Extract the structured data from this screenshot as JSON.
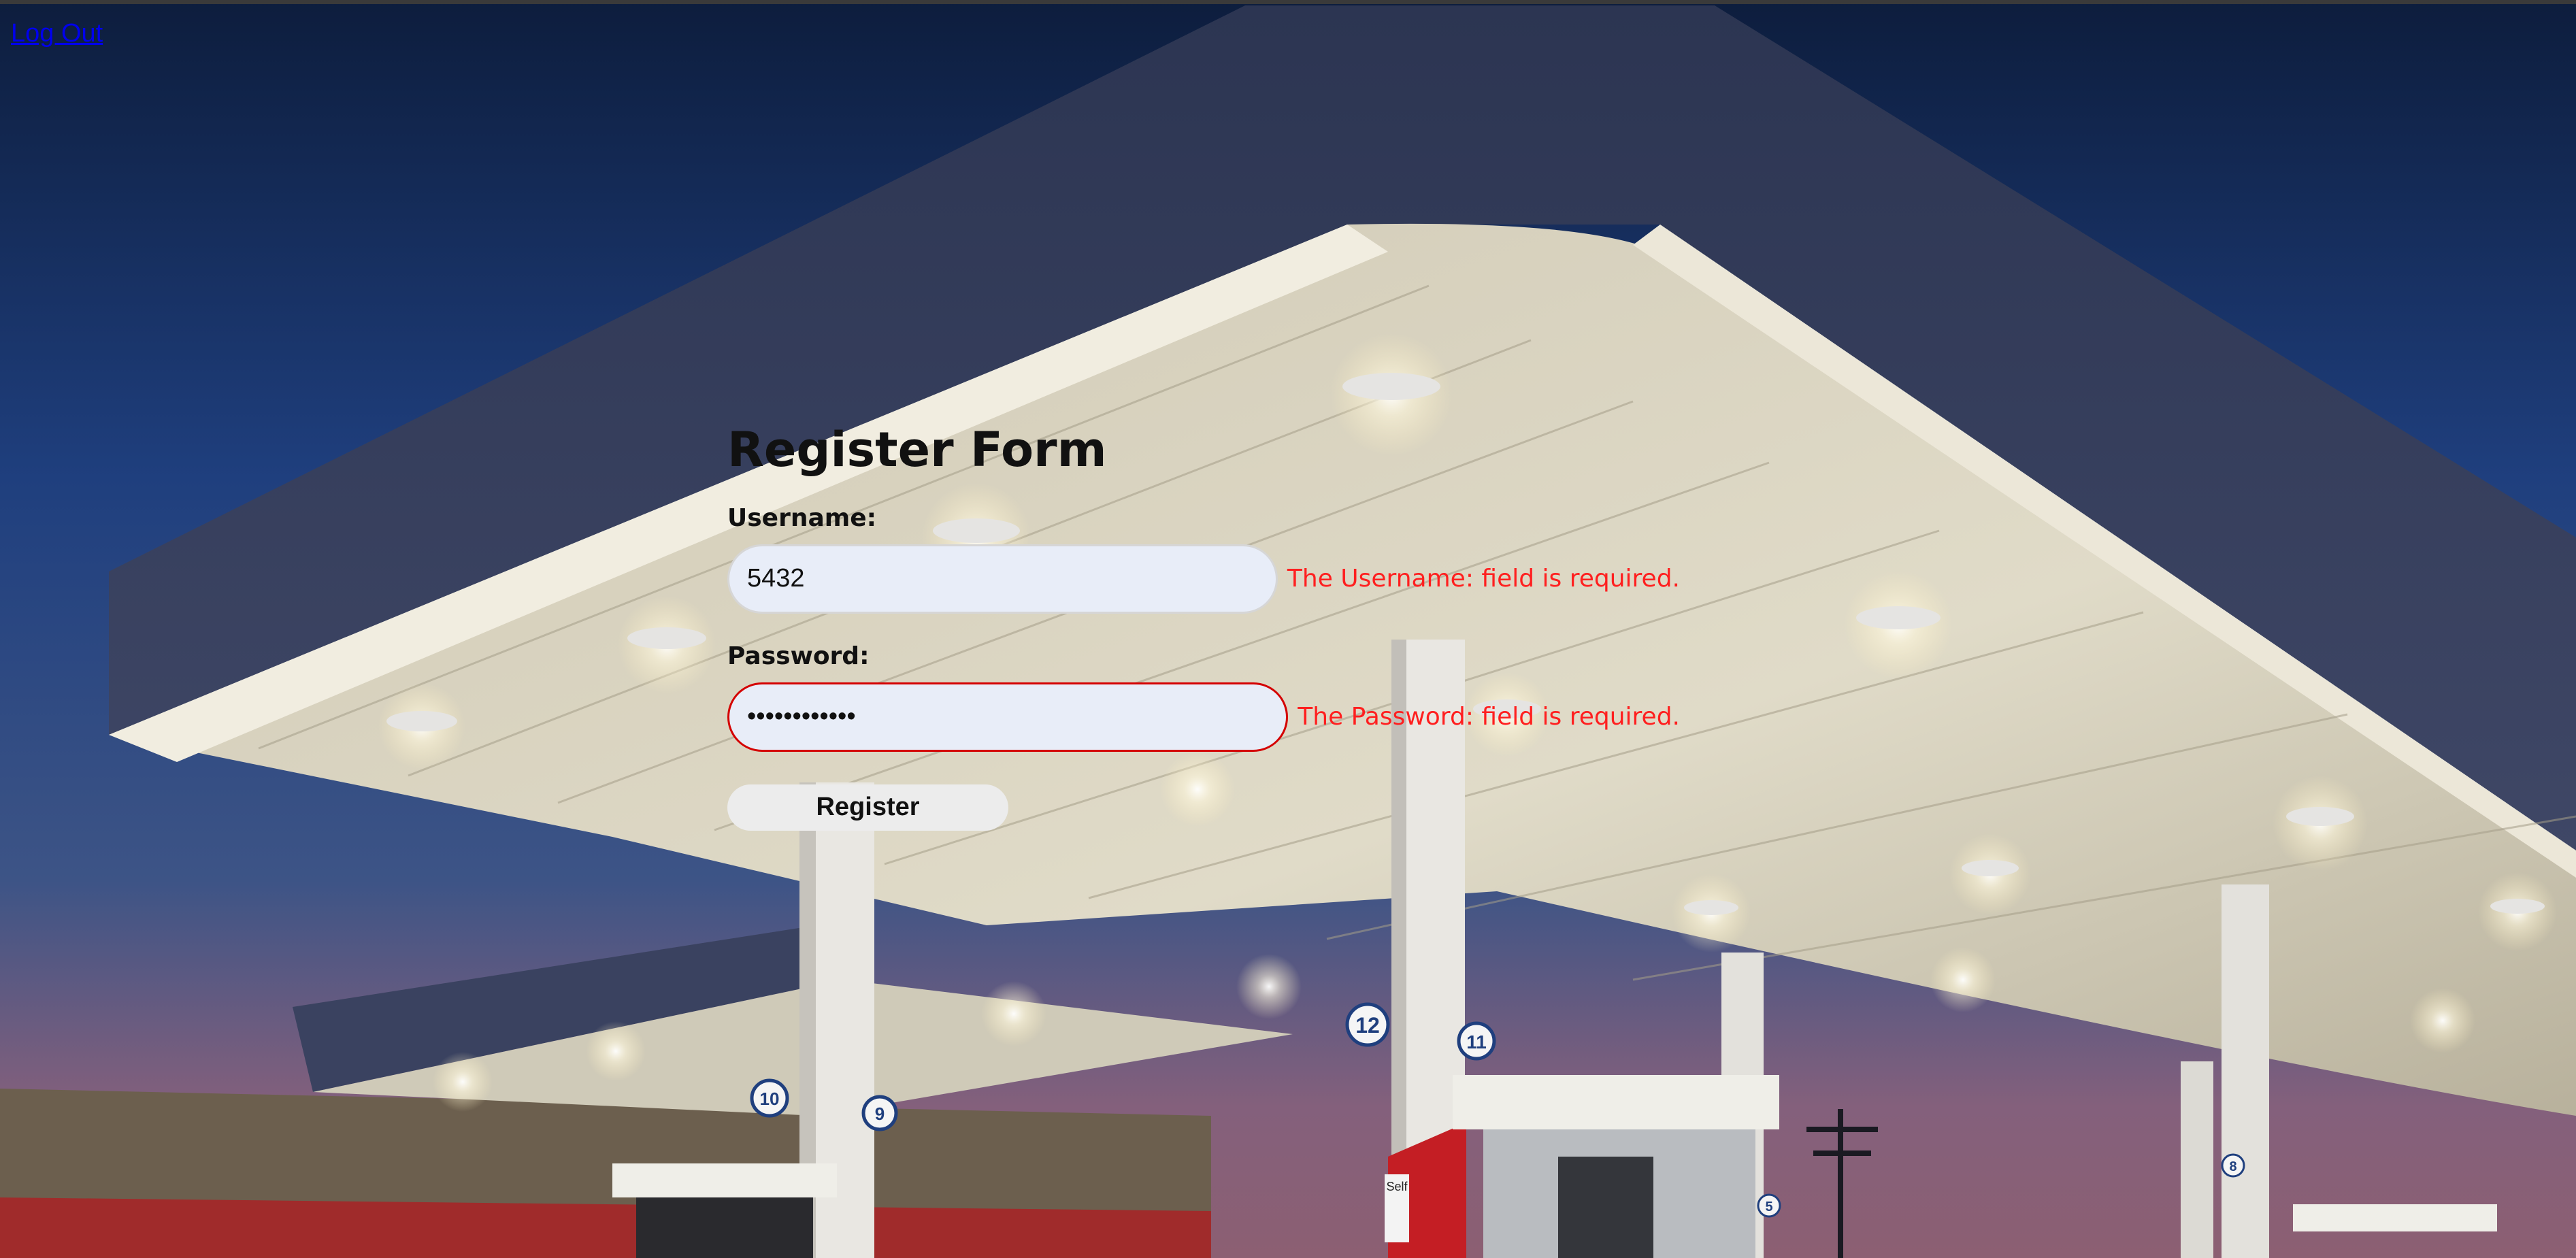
{
  "nav": {
    "logout_label": "Log Out"
  },
  "form": {
    "title": "Register Form",
    "username_label": "Username:",
    "username_value": "5432",
    "username_error": "The Username: field is required.",
    "password_label": "Password:",
    "password_value": "••••••••••••",
    "password_error": "The Password: field is required.",
    "submit_label": "Register"
  },
  "scene": {
    "pump_numbers": [
      "12",
      "11",
      "10",
      "9",
      "5",
      "8"
    ],
    "pump_sign": "Self"
  },
  "colors": {
    "link": "#0000ee",
    "error": "#ff1f1f",
    "invalid_border": "#d40000",
    "input_bg": "#e8edf8",
    "button_bg": "#ececec"
  }
}
